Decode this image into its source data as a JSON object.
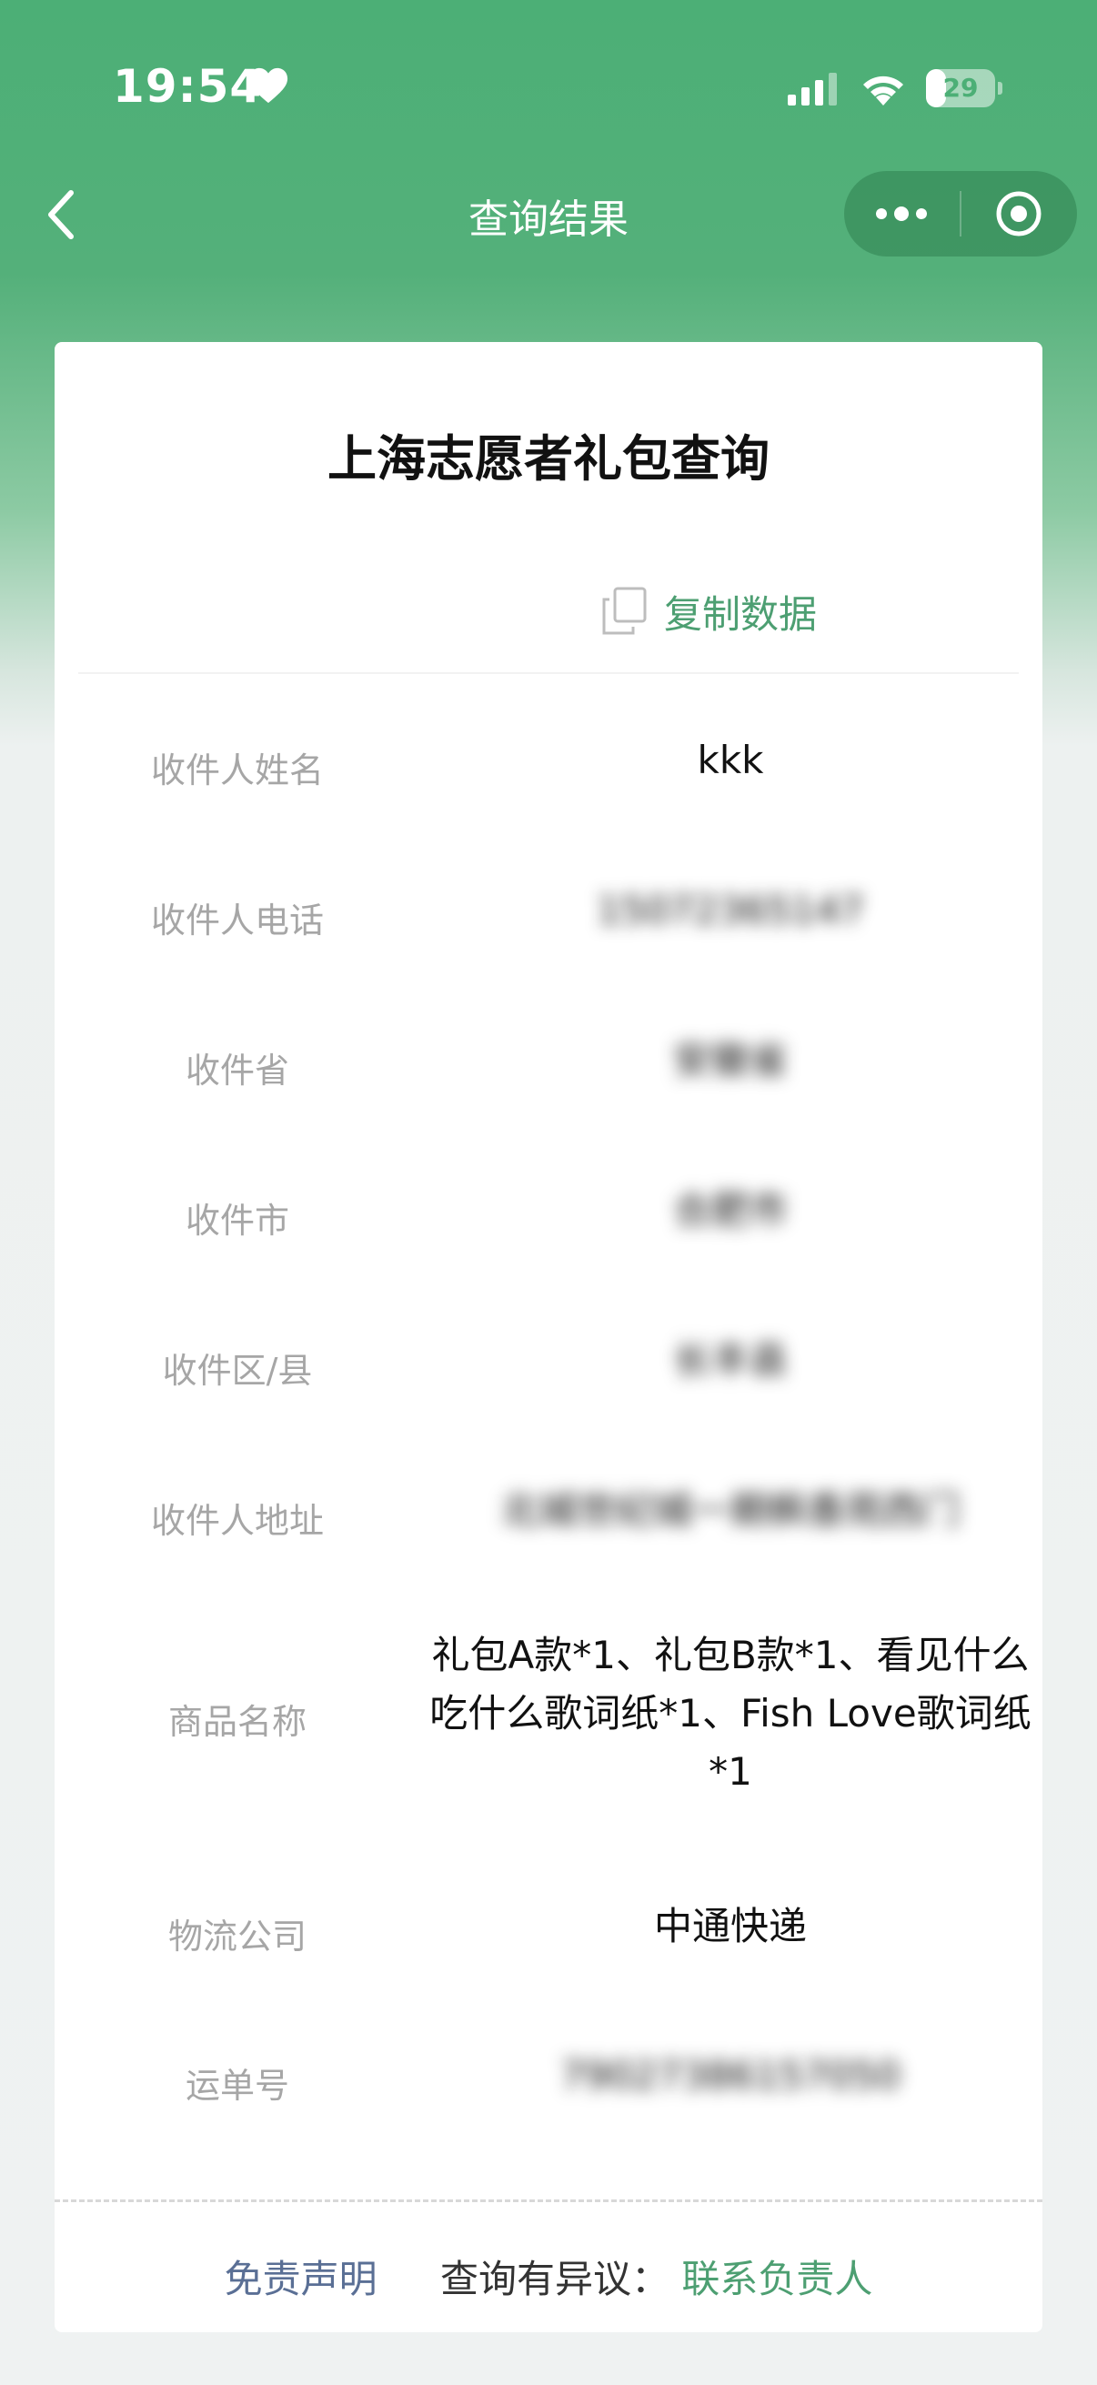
{
  "status_bar": {
    "time": "19:54",
    "battery_level": "29",
    "battery_fraction": 0.29
  },
  "nav": {
    "title": "查询结果"
  },
  "card": {
    "title": "上海志愿者礼包查询",
    "copy_label": "复制数据",
    "rows": [
      {
        "label": "收件人姓名",
        "value": "kkk"
      },
      {
        "label": "收件人电话",
        "value": "15072365147"
      },
      {
        "label": "收件省",
        "value": "安徽省"
      },
      {
        "label": "收件市",
        "value": "合肥市"
      },
      {
        "label": "收件区/县",
        "value": "长丰县"
      },
      {
        "label": "收件人地址",
        "value": "北城世纪城一期枫香苑西门"
      },
      {
        "label": "商品名称",
        "value": "礼包A款*1、礼包B款*1、看见什么吃什么歌词纸*1、Fish Love歌词纸*1"
      },
      {
        "label": "物流公司",
        "value": "中通快递"
      },
      {
        "label": "运单号",
        "value": "79027386157050"
      }
    ]
  },
  "footer": {
    "disclaimer": "免责声明",
    "query_text": "查询有异议：",
    "contact": "联系负责人"
  },
  "colors": {
    "accent_green": "#4d9f72",
    "header_green": "#4caf76",
    "disclaimer_blue": "#5a6f95"
  },
  "icons": [
    "heart-icon",
    "signal-icon",
    "wifi-icon",
    "battery-icon",
    "back-arrow-icon",
    "more-dots-icon",
    "target-icon",
    "copy-icon"
  ]
}
